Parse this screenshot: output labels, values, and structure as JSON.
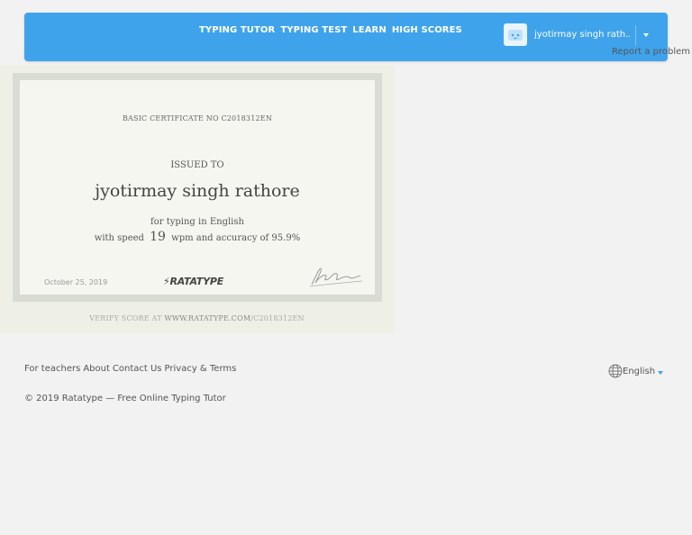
{
  "nav": {
    "items": [
      "TYPING TUTOR",
      "TYPING TEST",
      "LEARN",
      "HIGH SCORES"
    ],
    "username": "jyotirmay singh rath...",
    "report": "Report a problem"
  },
  "certificate": {
    "number_line": "BASIC CERTIFICATE NO C2018312EN",
    "issued_label": "ISSUED TO",
    "holder": "jyotirmay singh rathore",
    "for_line": "for typing in English",
    "speed_prefix": "with speed",
    "speed_value": "19",
    "speed_suffix": "wpm and accuracy of 95.9%",
    "date": "October 25, 2019",
    "logo": "RATATYPE",
    "verify_prefix": "VERIFY SCORE AT ",
    "verify_url": "WWW.RATATYPE.COM",
    "verify_suffix": "/C2018312EN"
  },
  "footer": {
    "links": [
      "For teachers",
      "About",
      "Contact Us",
      "Privacy & Terms"
    ],
    "copyright": "© 2019 Ratatype — Free Online Typing Tutor",
    "language": "English"
  },
  "colors": {
    "accent": "#3fa3ec",
    "background": "#f2f2f2"
  },
  "icons": [
    "user-avatar-icon",
    "chevron-down-icon",
    "globe-icon",
    "signature-image"
  ]
}
